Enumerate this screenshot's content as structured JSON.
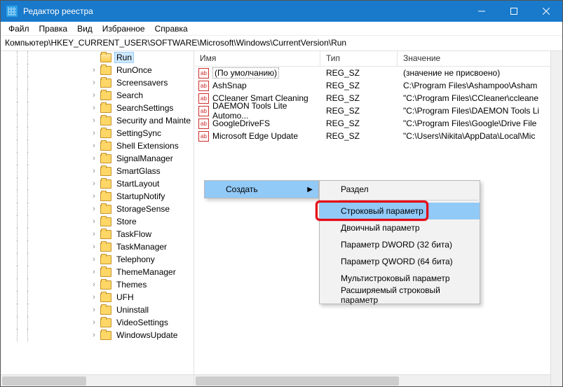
{
  "window": {
    "title": "Редактор реестра"
  },
  "menubar": [
    "Файл",
    "Правка",
    "Вид",
    "Избранное",
    "Справка"
  ],
  "path": "Компьютер\\HKEY_CURRENT_USER\\SOFTWARE\\Microsoft\\Windows\\CurrentVersion\\Run",
  "tree": {
    "selected": "Run",
    "items": [
      "Run",
      "RunOnce",
      "Screensavers",
      "Search",
      "SearchSettings",
      "Security and Mainte",
      "SettingSync",
      "Shell Extensions",
      "SignalManager",
      "SmartGlass",
      "StartLayout",
      "StartupNotify",
      "StorageSense",
      "Store",
      "TaskFlow",
      "TaskManager",
      "Telephony",
      "ThemeManager",
      "Themes",
      "UFH",
      "Uninstall",
      "VideoSettings",
      "WindowsUpdate"
    ]
  },
  "columns": {
    "name": "Имя",
    "type": "Тип",
    "value": "Значение"
  },
  "rows": [
    {
      "name": "(По умолчанию)",
      "type": "REG_SZ",
      "value": "(значение не присвоено)",
      "boxed": true
    },
    {
      "name": "AshSnap",
      "type": "REG_SZ",
      "value": "C:\\Program Files\\Ashampoo\\Asham"
    },
    {
      "name": "CCleaner Smart Cleaning",
      "type": "REG_SZ",
      "value": "\"C:\\Program Files\\CCleaner\\ccleane"
    },
    {
      "name": "DAEMON Tools Lite Automo...",
      "type": "REG_SZ",
      "value": "\"C:\\Program Files\\DAEMON Tools Li"
    },
    {
      "name": "GoogleDriveFS",
      "type": "REG_SZ",
      "value": "\"C:\\Program Files\\Google\\Drive File"
    },
    {
      "name": "Microsoft Edge Update",
      "type": "REG_SZ",
      "value": "\"C:\\Users\\Nikita\\AppData\\Local\\Mic"
    }
  ],
  "ctx_parent": {
    "label": "Создать"
  },
  "ctx_sub": [
    "Раздел",
    "---",
    "Строковый параметр",
    "Двоичный параметр",
    "Параметр DWORD (32 бита)",
    "Параметр QWORD (64 бита)",
    "Мультистроковый параметр",
    "Расширяемый строковый параметр"
  ],
  "ctx_highlight_index": 2
}
